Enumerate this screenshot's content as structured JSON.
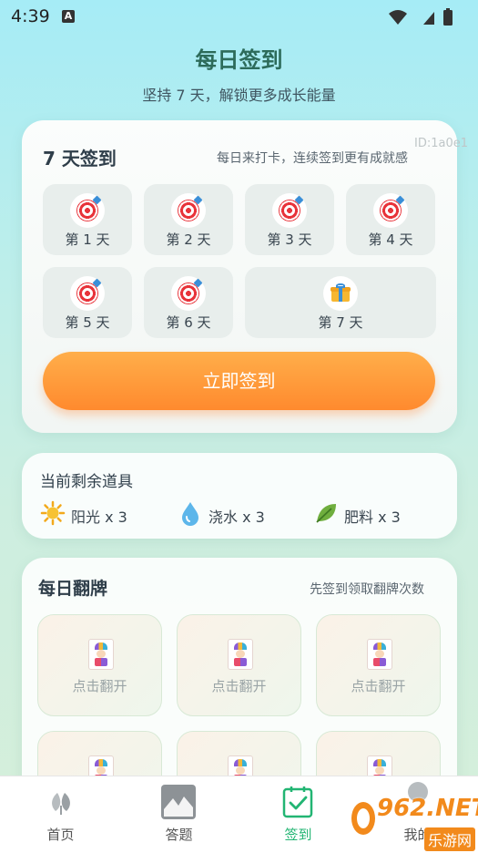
{
  "status": {
    "time": "4:39",
    "notif_icon": "A"
  },
  "header": {
    "title": "每日签到",
    "subtitle": "坚持 7 天，解锁更多成长能量"
  },
  "signin": {
    "title": "7 天签到",
    "subtitle": "每日来打卡，连续签到更有成就感",
    "id_tag": "ID:1a0e1",
    "days": [
      {
        "label": "第 1 天",
        "icon": "target-icon"
      },
      {
        "label": "第 2 天",
        "icon": "target-icon"
      },
      {
        "label": "第 3 天",
        "icon": "target-icon"
      },
      {
        "label": "第 4 天",
        "icon": "target-icon"
      },
      {
        "label": "第 5 天",
        "icon": "target-icon"
      },
      {
        "label": "第 6 天",
        "icon": "target-icon"
      },
      {
        "label": "第 7 天",
        "icon": "gift-icon"
      }
    ],
    "button_label": "立即签到"
  },
  "props": {
    "title": "当前剩余道具",
    "items": [
      {
        "label": "阳光 x 3",
        "icon": "sun-icon"
      },
      {
        "label": "浇水 x 3",
        "icon": "water-drop-icon"
      },
      {
        "label": "肥料 x 3",
        "icon": "leaf-icon"
      }
    ]
  },
  "flip": {
    "title": "每日翻牌",
    "subtitle": "先签到领取翻牌次数",
    "card_label": "点击翻开",
    "cards": [
      {
        "label": "点击翻开"
      },
      {
        "label": "点击翻开"
      },
      {
        "label": "点击翻开"
      },
      {
        "label": ""
      },
      {
        "label": ""
      },
      {
        "label": ""
      }
    ]
  },
  "tabs": [
    {
      "label": "首页",
      "icon": "home-icon"
    },
    {
      "label": "答题",
      "icon": "quiz-icon"
    },
    {
      "label": "签到",
      "icon": "checkin-icon",
      "active": true
    },
    {
      "label": "我的",
      "icon": "profile-icon"
    }
  ],
  "watermark": {
    "text": "962.NET",
    "sub": "乐游网"
  },
  "colors": {
    "accent": "#22b573",
    "button": "#ff8a2e",
    "title": "#2d6b5a"
  }
}
